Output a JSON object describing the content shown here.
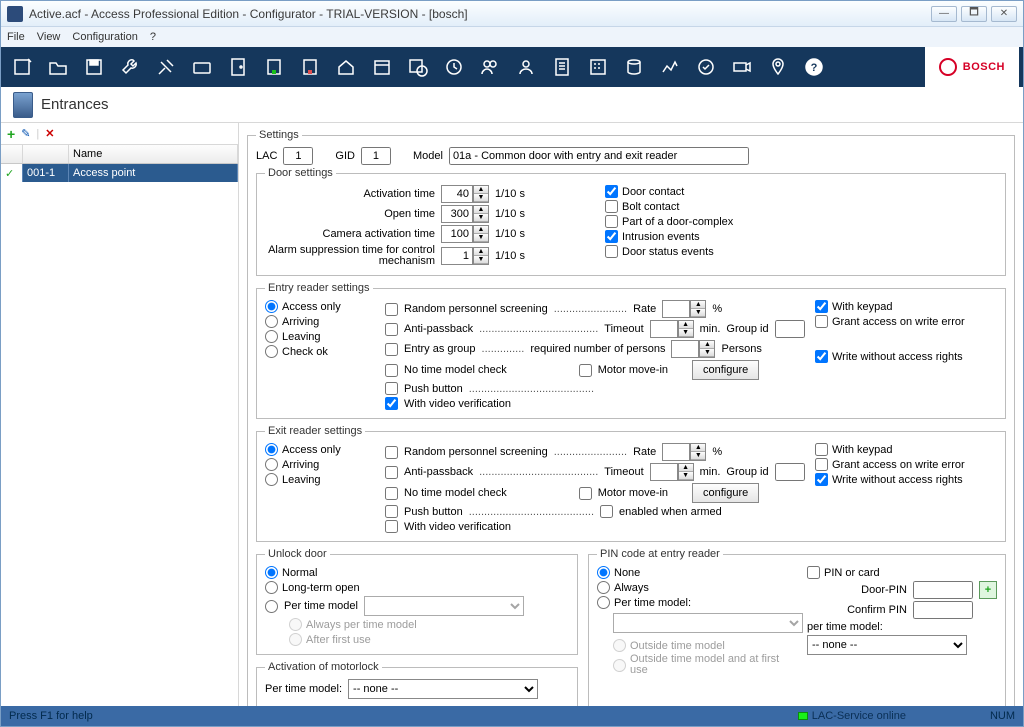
{
  "window": {
    "title": "Active.acf - Access Professional Edition - Configurator - TRIAL-VERSION - [bosch]"
  },
  "menu": {
    "file": "File",
    "view": "View",
    "configuration": "Configuration",
    "help": "?"
  },
  "brand": "BOSCH",
  "subheader": "Entrances",
  "leftgrid": {
    "col_name": "Name",
    "row_check": "✓",
    "row_id": "001-1",
    "row_name": "Access point"
  },
  "settings": {
    "legend": "Settings",
    "lac_lbl": "LAC",
    "lac_val": "1",
    "gid_lbl": "GID",
    "gid_val": "1",
    "model_lbl": "Model",
    "model_val": "01a - Common door with entry and exit reader"
  },
  "door": {
    "legend": "Door settings",
    "act_time_lbl": "Activation time",
    "act_time_val": "40",
    "unit": "1/10 s",
    "open_time_lbl": "Open time",
    "open_time_val": "300",
    "cam_act_lbl": "Camera activation time",
    "cam_act_val": "100",
    "alarm_lbl": "Alarm suppression time for control mechanism",
    "alarm_val": "1",
    "door_contact": "Door contact",
    "bolt_contact": "Bolt contact",
    "part_complex": "Part of a door-complex",
    "intrusion": "Intrusion events",
    "door_status": "Door status events"
  },
  "entry": {
    "legend": "Entry reader settings",
    "r_access": "Access only",
    "r_arriving": "Arriving",
    "r_leaving": "Leaving",
    "r_checkok": "Check ok",
    "rand_scr": "Random personnel screening",
    "rate": "Rate",
    "pct": "%",
    "anti": "Anti-passback",
    "timeout": "Timeout",
    "min": "min.",
    "groupid": "Group id",
    "entryasgroup": "Entry as group",
    "reqpersons": "required number of persons",
    "persons": "Persons",
    "notime": "No time model check",
    "motor": "Motor move-in",
    "configure": "configure",
    "push": "Push button",
    "withvideo": "With video verification",
    "withkeypad": "With keypad",
    "grant": "Grant access on write error",
    "writewo": "Write without access rights"
  },
  "exit": {
    "legend": "Exit reader settings",
    "r_access": "Access only",
    "r_arriving": "Arriving",
    "r_leaving": "Leaving",
    "rand_scr": "Random personnel screening",
    "rate": "Rate",
    "pct": "%",
    "anti": "Anti-passback",
    "timeout": "Timeout",
    "min": "min.",
    "groupid": "Group id",
    "notime": "No time model check",
    "motor": "Motor move-in",
    "configure": "configure",
    "push": "Push button",
    "enabledarmed": "enabled when armed",
    "withvideo": "With video verification",
    "withkeypad": "With keypad",
    "grant": "Grant access on write error",
    "writewo": "Write without access rights"
  },
  "unlock": {
    "legend": "Unlock door",
    "normal": "Normal",
    "longterm": "Long-term open",
    "pertm": "Per time model",
    "always_tm": "Always per time model",
    "afterfirst": "After first use"
  },
  "motorlock": {
    "legend": "Activation of motorlock",
    "pertm": "Per time model:",
    "none": "-- none --"
  },
  "pincode": {
    "legend": "PIN code at entry reader",
    "none": "None",
    "always": "Always",
    "pertm": "Per time model:",
    "outside": "Outside time model",
    "outsidefirst": "Outside time model and at first use",
    "pinorcard": "PIN or card",
    "doorpin": "Door-PIN",
    "confirm": "Confirm PIN",
    "pertm2": "per time model:",
    "none2": "-- none --"
  },
  "statusbar": {
    "help": "Press F1 for help",
    "lac": "LAC-Service online",
    "num": "NUM"
  }
}
